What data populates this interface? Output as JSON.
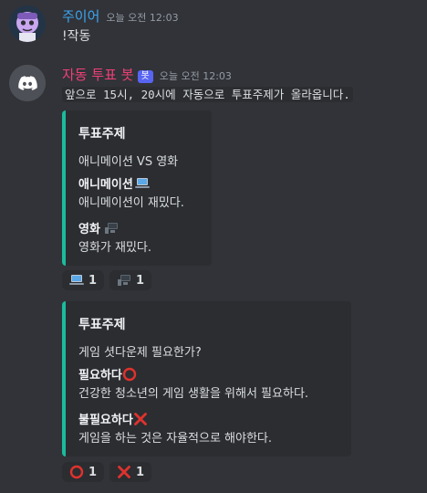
{
  "messages": [
    {
      "author": "주이어",
      "author_color": "#3ba5f2",
      "timestamp": "오늘 오전 12:03",
      "text": "!작동"
    },
    {
      "author": "자동 투표 봇",
      "author_color": "#f23f77",
      "bot_tag": "봇",
      "timestamp": "오늘 오전 12:03",
      "text": "앞으로 15시, 20시에 자동으로 투표주제가 올라옵니다."
    }
  ],
  "embeds": [
    {
      "title": "투표주제",
      "description": "애니메이션 VS 영화",
      "accent": "#1abc9c",
      "fields": [
        {
          "name": "애니메이션",
          "emoji": "laptop-icon",
          "value": "애니메이션이 재밌다."
        },
        {
          "name": "영화",
          "emoji": "desktop-icon",
          "value": "영화가 재밌다."
        }
      ],
      "reactions": [
        {
          "emoji": "laptop-icon",
          "count": "1"
        },
        {
          "emoji": "desktop-icon",
          "count": "1"
        }
      ]
    },
    {
      "title": "투표주제",
      "description": "게임 셧다운제 필요한가?",
      "accent": "#1abc9c",
      "fields": [
        {
          "name": "필요하다",
          "emoji": "red-circle-icon",
          "value": "건강한 청소년의 게임 생활을 위해서 필요하다."
        },
        {
          "name": "불필요하다",
          "emoji": "red-x-icon",
          "value": "게임을 하는 것은 자율적으로 해야한다."
        }
      ],
      "reactions": [
        {
          "emoji": "red-circle-icon",
          "count": "1"
        },
        {
          "emoji": "red-x-icon",
          "count": "1"
        }
      ]
    }
  ]
}
